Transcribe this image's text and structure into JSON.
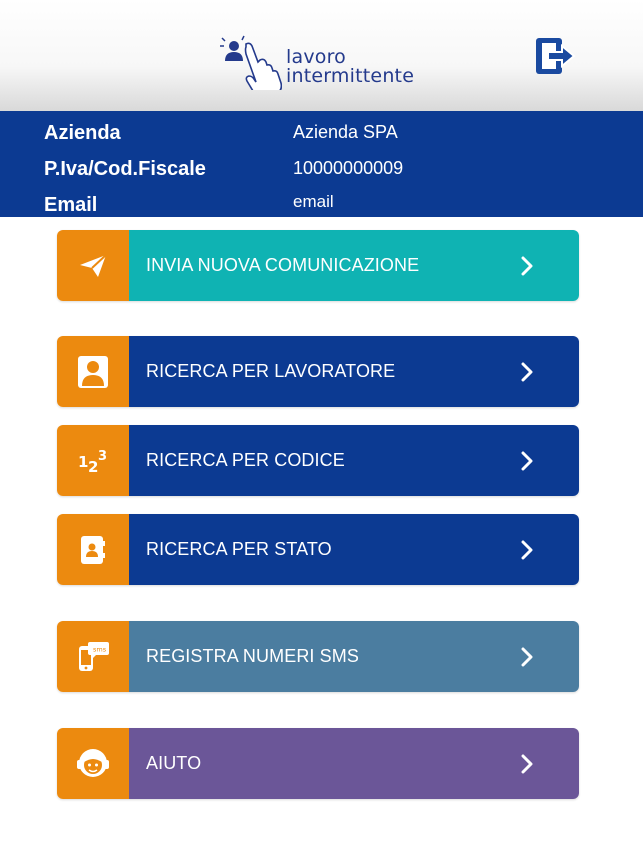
{
  "header": {
    "logo_line1": "lavoro",
    "logo_line2": "intermittente"
  },
  "company": {
    "fields": [
      {
        "label": "Azienda",
        "value": "Azienda SPA"
      },
      {
        "label": "P.Iva/Cod.Fiscale",
        "value": "10000000009"
      },
      {
        "label": "Email",
        "value": "email"
      }
    ]
  },
  "menu": {
    "items": [
      {
        "label": "INVIA NUOVA COMUNICAZIONE",
        "icon": "paper-plane-icon",
        "color": "#0fb3b3"
      },
      {
        "label": "RICERCA PER LAVORATORE",
        "icon": "user-icon",
        "color": "#0c3a92"
      },
      {
        "label": "RICERCA PER CODICE",
        "icon": "numbers-123-icon",
        "color": "#0c3a92"
      },
      {
        "label": "RICERCA PER STATO",
        "icon": "address-book-icon",
        "color": "#0c3a92"
      },
      {
        "label": "REGISTRA NUMERI SMS",
        "icon": "sms-phone-icon",
        "color": "#4b7da0"
      },
      {
        "label": "AIUTO",
        "icon": "support-agent-icon",
        "color": "#6b5698"
      }
    ],
    "icon_bg": "#ec8a0f"
  }
}
